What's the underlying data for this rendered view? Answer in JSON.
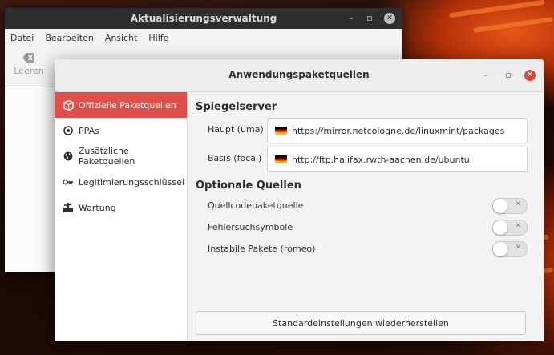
{
  "bg_window": {
    "title": "Aktualisierungsverwaltung",
    "menu": [
      "Datei",
      "Bearbeiten",
      "Ansicht",
      "Hilfe"
    ],
    "toolbar_clear": "Leeren"
  },
  "dialog": {
    "title": "Anwendungspaketquellen",
    "sidebar": [
      {
        "label": "Offizielle Paketquellen",
        "icon": "package-icon",
        "active": true
      },
      {
        "label": "PPAs",
        "icon": "ppa-icon",
        "active": false
      },
      {
        "label": "Zusätzliche Paketquellen",
        "icon": "globe-icon",
        "active": false
      },
      {
        "label": "Legitimierungsschlüssel",
        "icon": "key-icon",
        "active": false
      },
      {
        "label": "Wartung",
        "icon": "maintenance-icon",
        "active": false
      }
    ],
    "mirrors": {
      "heading": "Spiegelserver",
      "main_label": "Haupt (uma)",
      "main_url": "https://mirror.netcologne.de/linuxmint/packages",
      "base_label": "Basis (focal)",
      "base_url": "http://ftp.halifax.rwth-aachen.de/ubuntu"
    },
    "optional": {
      "heading": "Optionale Quellen",
      "items": [
        {
          "label": "Quellcodepaketquelle",
          "enabled": false
        },
        {
          "label": "Fehlersuchsymbole",
          "enabled": false
        },
        {
          "label": "Instabile Pakete (romeo)",
          "enabled": false
        }
      ]
    },
    "restore_button": "Standardeinstellungen wiederherstellen"
  },
  "colors": {
    "accent": "#e0504a",
    "close_button": "#e0463d"
  }
}
